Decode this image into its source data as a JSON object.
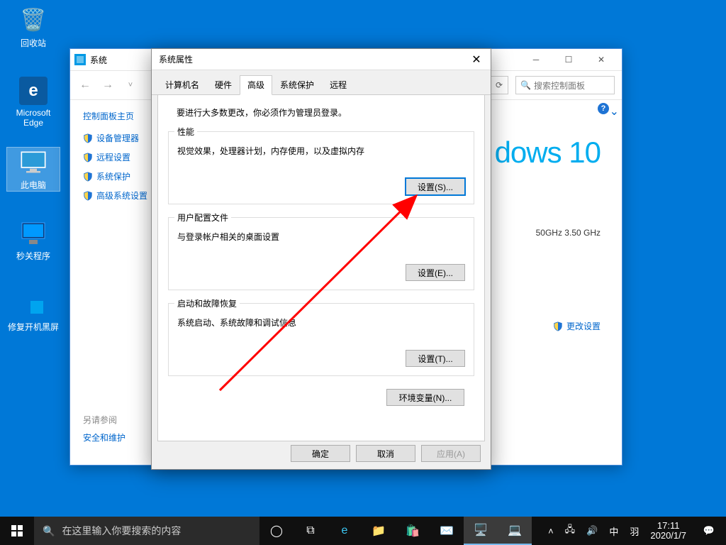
{
  "desktop": {
    "recycle": "回收站",
    "edge": "Microsoft\nEdge",
    "pc": "此电脑",
    "shutdown_tool": "秒关程序",
    "repair": "修复开机黑屏"
  },
  "cp": {
    "title": "系统",
    "search_placeholder": "搜索控制面板",
    "home": "控制面板主页",
    "links": [
      "设备管理器",
      "远程设置",
      "系统保护",
      "高级系统设置"
    ],
    "seealso_hd": "另请参阅",
    "seealso_link": "安全和维护",
    "win10": "dows 10",
    "cpu": "50GHz  3.50 GHz",
    "change_settings": "更改设置"
  },
  "sp": {
    "title": "系统属性",
    "tabs": [
      "计算机名",
      "硬件",
      "高级",
      "系统保护",
      "远程"
    ],
    "admin_note": "要进行大多数更改，你必须作为管理员登录。",
    "perf": {
      "title": "性能",
      "desc": "视觉效果，处理器计划，内存使用，以及虚拟内存",
      "btn": "设置(S)..."
    },
    "profile": {
      "title": "用户配置文件",
      "desc": "与登录帐户相关的桌面设置",
      "btn": "设置(E)..."
    },
    "startup": {
      "title": "启动和故障恢复",
      "desc": "系统启动、系统故障和调试信息",
      "btn": "设置(T)..."
    },
    "env_btn": "环境变量(N)...",
    "ok": "确定",
    "cancel": "取消",
    "apply": "应用(A)"
  },
  "taskbar": {
    "search_placeholder": "在这里输入你要搜索的内容",
    "ime1": "中",
    "ime2": "羽",
    "time": "17:11",
    "date": "2020/1/7"
  }
}
